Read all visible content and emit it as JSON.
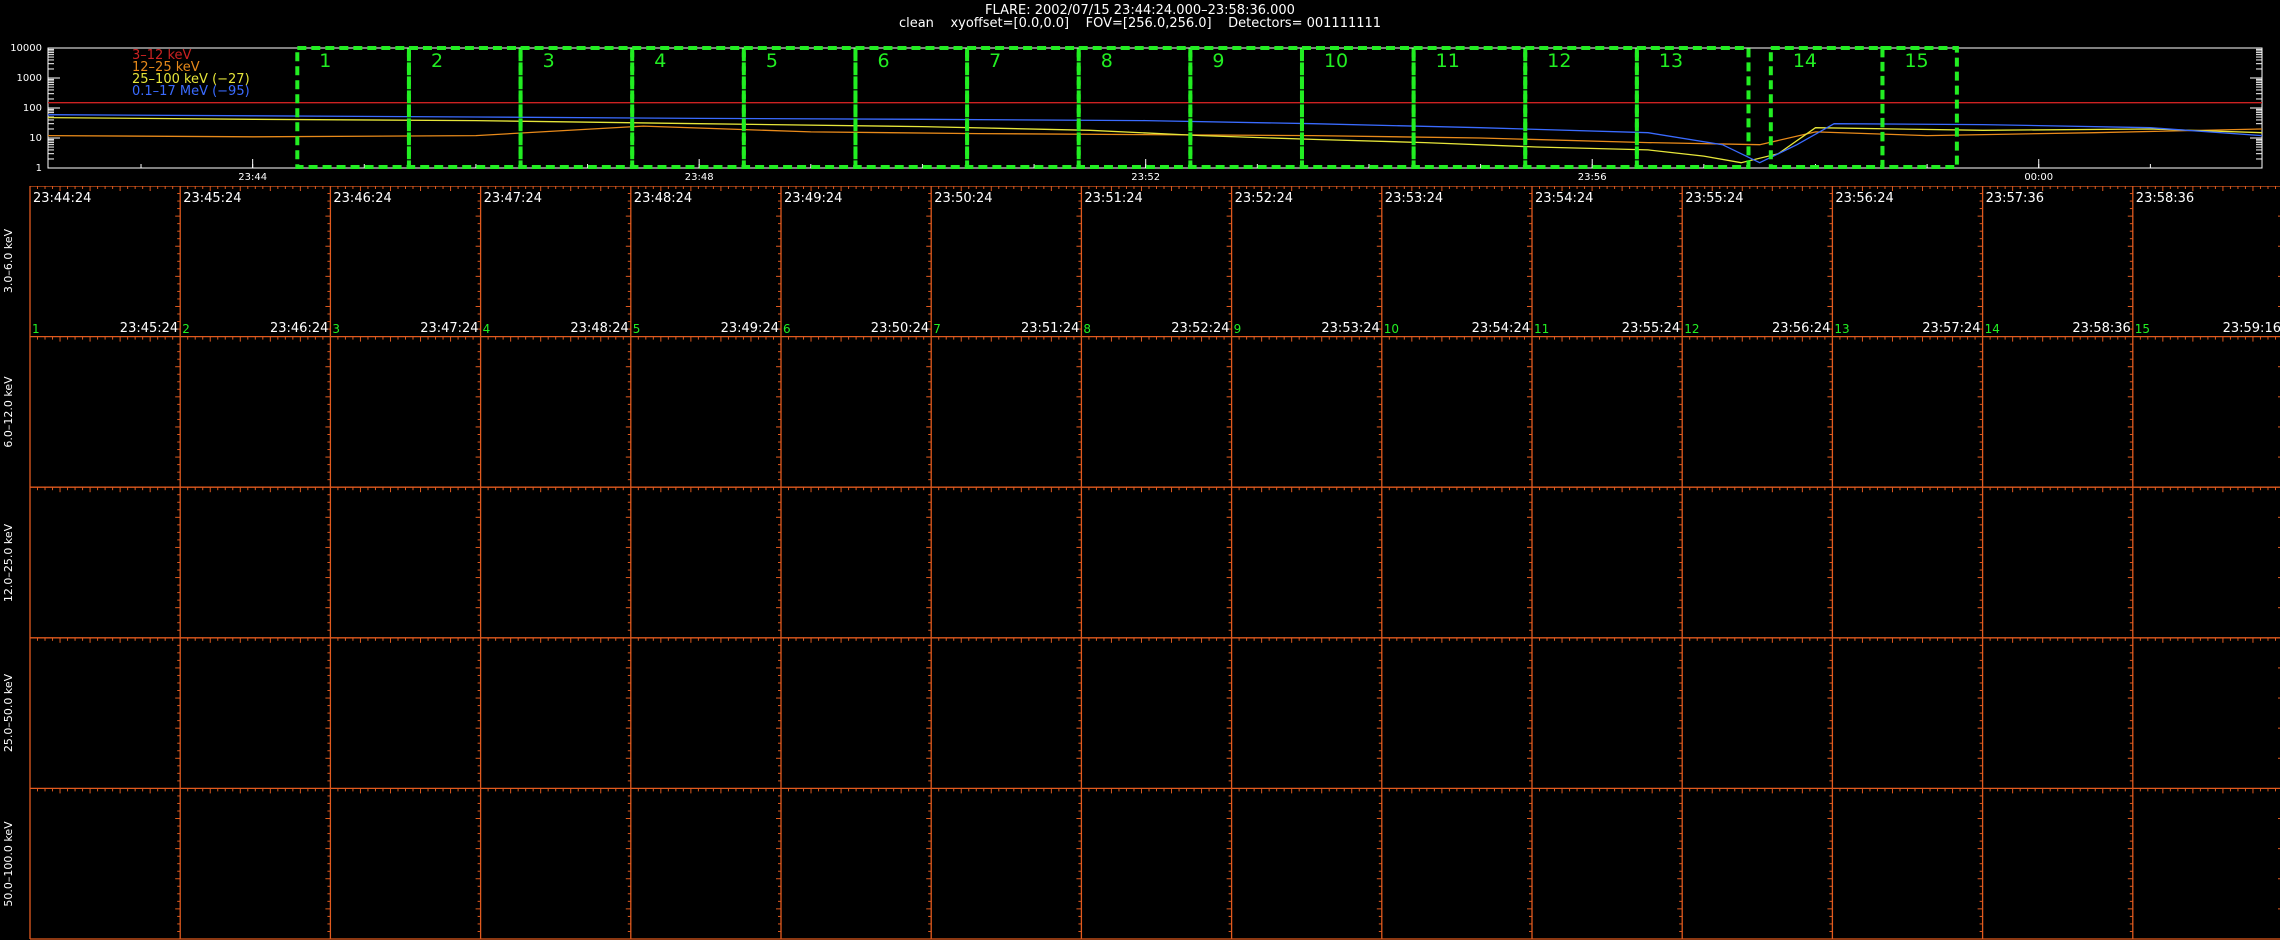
{
  "header": {
    "title": "FLARE: 2002/07/15 23:44:24.000–23:58:36.000",
    "subtitle": "clean    xyoffset=[0.0,0.0]    FOV=[256.0,256.0]    Detectors= 001111111"
  },
  "chart_data": [
    {
      "type": "line",
      "yscale": "log",
      "ylim": [
        1,
        10000
      ],
      "y_ticks": [
        "10000",
        "1000",
        "100",
        "10",
        "1"
      ],
      "xlim": [
        "23:42:10",
        "00:02:00"
      ],
      "x_ticks": [
        "23:44",
        "23:48",
        "23:52",
        "23:56",
        "00:00"
      ],
      "series": [
        {
          "name": "3–12 keV",
          "color": "#cc2222",
          "x": [
            "23:42:10",
            "23:46:00",
            "23:50:00",
            "23:54:00",
            "23:58:00",
            "00:02:00"
          ],
          "y": [
            150,
            150,
            150,
            150,
            150,
            150
          ]
        },
        {
          "name": "12–25 keV",
          "color": "#e88a1a",
          "x": [
            "23:42:10",
            "23:44:00",
            "23:46:00",
            "23:47:30",
            "23:49:00",
            "23:50:30",
            "23:52:00",
            "23:53:30",
            "23:55:00",
            "23:56:30",
            "23:57:30",
            "23:58:00",
            "23:59:00",
            "00:00:30",
            "00:02:00"
          ],
          "y": [
            12,
            11,
            12,
            25,
            16,
            14,
            13,
            12,
            10,
            7,
            6,
            16,
            12,
            15,
            20
          ]
        },
        {
          "name": "25–100 keV (−27)",
          "color": "#e6e63a",
          "x": [
            "23:42:10",
            "23:44:00",
            "23:46:00",
            "23:48:00",
            "23:50:00",
            "23:51:30",
            "23:52:30",
            "23:53:30",
            "23:54:30",
            "23:55:30",
            "23:56:30",
            "23:57:00",
            "23:57:20",
            "23:57:40",
            "23:58:00",
            "23:59:30",
            "00:01:00",
            "00:02:00"
          ],
          "y": [
            48,
            42,
            38,
            30,
            24,
            18,
            12,
            9,
            7,
            5,
            4,
            2.5,
            1.5,
            3,
            22,
            18,
            20,
            15
          ]
        },
        {
          "name": "0.1–17 MeV (−95)",
          "color": "#3a6bff",
          "x": [
            "23:42:10",
            "23:44:00",
            "23:46:00",
            "23:48:00",
            "23:50:00",
            "23:52:00",
            "23:53:30",
            "23:55:00",
            "23:56:30",
            "23:57:10",
            "23:57:30",
            "23:57:50",
            "23:58:10",
            "23:59:30",
            "00:01:00",
            "00:02:00"
          ],
          "y": [
            60,
            55,
            50,
            45,
            42,
            38,
            30,
            22,
            15,
            6,
            1.5,
            6,
            30,
            28,
            22,
            12
          ]
        }
      ],
      "intervals": [
        "1",
        "2",
        "3",
        "4",
        "5",
        "6",
        "7",
        "8",
        "9",
        "10",
        "11",
        "12",
        "13",
        "14",
        "15"
      ]
    },
    {
      "type": "table",
      "rows": [
        "3.0–6.0 keV",
        "6.0–12.0 keV",
        "12.0–25.0 keV",
        "25.0–50.0 keV",
        "50.0–100.0 keV"
      ],
      "start_times": [
        "23:44:24",
        "23:45:24",
        "23:46:24",
        "23:47:24",
        "23:48:24",
        "23:49:24",
        "23:50:24",
        "23:51:24",
        "23:52:24",
        "23:53:24",
        "23:54:24",
        "23:55:24",
        "23:56:24",
        "23:57:36",
        "23:58:36"
      ],
      "end_times": [
        "23:45:24",
        "23:46:24",
        "23:47:24",
        "23:48:24",
        "23:49:24",
        "23:50:24",
        "23:51:24",
        "23:52:24",
        "23:53:24",
        "23:54:24",
        "23:55:24",
        "23:56:24",
        "23:57:24",
        "23:58:36",
        "23:59:16"
      ],
      "interval_labels": [
        "1",
        "2",
        "3",
        "4",
        "5",
        "6",
        "7",
        "8",
        "9",
        "10",
        "11",
        "12",
        "13",
        "14",
        "15"
      ]
    }
  ],
  "colors": {
    "grid": "#e05a1e",
    "interval_box": "#22ee22",
    "axis": "#ffffff"
  }
}
